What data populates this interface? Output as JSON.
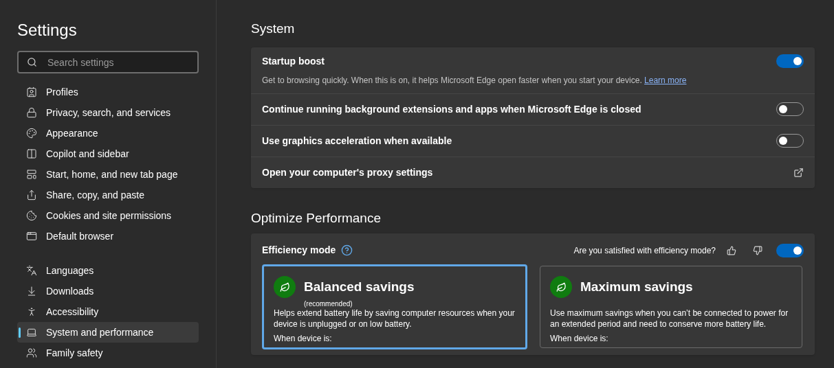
{
  "sidebar": {
    "title": "Settings",
    "search": {
      "placeholder": "Search settings"
    },
    "groups": [
      [
        {
          "label": "Profiles",
          "selected": false
        },
        {
          "label": "Privacy, search, and services",
          "selected": false
        },
        {
          "label": "Appearance",
          "selected": false
        },
        {
          "label": "Copilot and sidebar",
          "selected": false
        },
        {
          "label": "Start, home, and new tab page",
          "selected": false
        },
        {
          "label": "Share, copy, and paste",
          "selected": false
        },
        {
          "label": "Cookies and site permissions",
          "selected": false
        },
        {
          "label": "Default browser",
          "selected": false
        }
      ],
      [
        {
          "label": "Languages",
          "selected": false
        },
        {
          "label": "Downloads",
          "selected": false
        },
        {
          "label": "Accessibility",
          "selected": false
        },
        {
          "label": "System and performance",
          "selected": true
        },
        {
          "label": "Family safety",
          "selected": false
        }
      ]
    ]
  },
  "sections": [
    {
      "title": "System",
      "rows": [
        {
          "kind": "toggle",
          "title": "Startup boost",
          "description": "Get to browsing quickly. When this is on, it helps Microsoft Edge open faster when you start your device.",
          "link": "Learn more",
          "on": true
        },
        {
          "kind": "toggle",
          "title": "Continue running background extensions and apps when Microsoft Edge is closed",
          "on": false
        },
        {
          "kind": "toggle",
          "title": "Use graphics acceleration when available",
          "on": false
        },
        {
          "kind": "external",
          "title": "Open your computer's proxy settings"
        }
      ]
    },
    {
      "title": "Optimize Performance",
      "efficiency": {
        "label": "Efficiency mode",
        "question": "Are you satisfied with efficiency mode?",
        "on": true,
        "cards": [
          {
            "title": "Balanced savings",
            "subtitle": "(recommended)",
            "description": "Helps extend battery life by saving computer resources when your device is unplugged or on low battery.",
            "footer": "When device is:",
            "selected": true
          },
          {
            "title": "Maximum savings",
            "description": "Use maximum savings when you can’t be connected to power for an extended period and need to conserve more battery life.",
            "footer": "When device is:",
            "selected": false
          }
        ]
      }
    }
  ]
}
